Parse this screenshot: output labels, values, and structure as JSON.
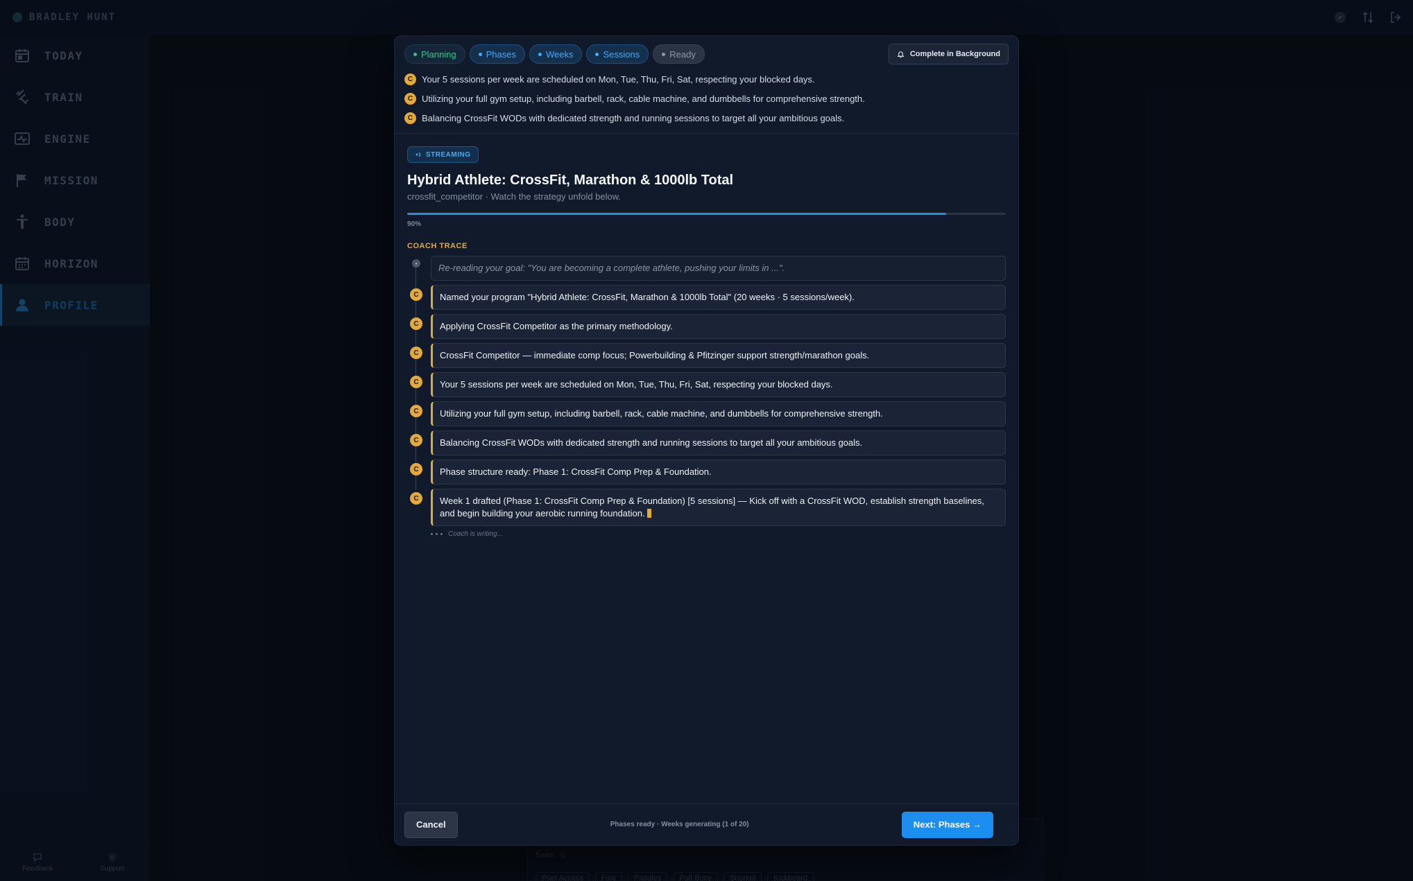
{
  "app": {
    "user_name": "BRADLEY HUNT"
  },
  "sidebar": {
    "items": [
      {
        "label": "TODAY",
        "icon": "calendar-icon"
      },
      {
        "label": "TRAIN",
        "icon": "dumbbell-icon"
      },
      {
        "label": "ENGINE",
        "icon": "heartbeat-icon"
      },
      {
        "label": "MISSION",
        "icon": "flag-icon"
      },
      {
        "label": "BODY",
        "icon": "person-icon"
      },
      {
        "label": "HORIZON",
        "icon": "calendar-grid-icon"
      },
      {
        "label": "PROFILE",
        "icon": "user-icon",
        "active": true
      }
    ],
    "bottom": [
      {
        "label": "Feedback",
        "icon": "chat-icon"
      },
      {
        "label": "Support",
        "icon": "gear-icon"
      }
    ]
  },
  "background": {
    "row_label": "Swim",
    "row_value": "0",
    "chips": [
      "Pool Access",
      "Fins",
      "Paddles",
      "Pull Buoy",
      "Snorkel",
      "Kickboard"
    ]
  },
  "modal": {
    "steps": [
      {
        "label": "Planning",
        "state": "done",
        "color": "#2fc486"
      },
      {
        "label": "Phases",
        "state": "active",
        "color": "#48a8f2"
      },
      {
        "label": "Weeks",
        "state": "active",
        "color": "#48a8f2"
      },
      {
        "label": "Sessions",
        "state": "active",
        "color": "#48a8f2"
      },
      {
        "label": "Ready",
        "state": "pending",
        "color": "#8b96a8"
      }
    ],
    "background_button": "Complete in Background",
    "summary": [
      "Your 5 sessions per week are scheduled on Mon, Tue, Thu, Fri, Sat, respecting your blocked days.",
      "Utilizing your full gym setup, including barbell, rack, cable machine, and dumbbells for comprehensive strength.",
      "Balancing CrossFit WODs with dedicated strength and running sessions to target all your ambitious goals."
    ],
    "badge_letter": "C",
    "streaming_label": "STREAMING",
    "program_title": "Hybrid Athlete: CrossFit, Marathon & 1000lb Total",
    "program_subtitle": "crossfit_competitor · Watch the strategy unfold below.",
    "progress_percent": 90,
    "progress_label": "90%",
    "trace_label": "COACH TRACE",
    "trace": [
      {
        "text": "Re-reading your goal: \"You are becoming a complete athlete, pushing your limits in ...\".",
        "kind": "muted"
      },
      {
        "text": "Named your program \"Hybrid Athlete: CrossFit, Marathon & 1000lb Total\" (20 weeks · 5 sessions/week).",
        "kind": "coach"
      },
      {
        "text": "Applying CrossFit Competitor as the primary methodology.",
        "kind": "coach"
      },
      {
        "text": "CrossFit Competitor — immediate comp focus; Powerbuilding & Pfitzinger support strength/marathon goals.",
        "kind": "coach"
      },
      {
        "text": "Your 5 sessions per week are scheduled on Mon, Tue, Thu, Fri, Sat, respecting your blocked days.",
        "kind": "coach"
      },
      {
        "text": "Utilizing your full gym setup, including barbell, rack, cable machine, and dumbbells for comprehensive strength.",
        "kind": "coach"
      },
      {
        "text": "Balancing CrossFit WODs with dedicated strength and running sessions to target all your ambitious goals.",
        "kind": "coach"
      },
      {
        "text": "Phase structure ready: Phase 1: CrossFit Comp Prep & Foundation.",
        "kind": "coach"
      },
      {
        "text": "Week 1 drafted (Phase 1: CrossFit Comp Prep & Foundation) [5 sessions] — Kick off with a CrossFit WOD, establish strength baselines, and begin building your aerobic running foundation.",
        "kind": "coach",
        "streaming": true
      }
    ],
    "writing_label": "Coach is writing...",
    "footer": {
      "cancel_label": "Cancel",
      "status": "Phases ready · Weeks generating (1 of 20)",
      "next_label": "Next: Phases →"
    }
  }
}
